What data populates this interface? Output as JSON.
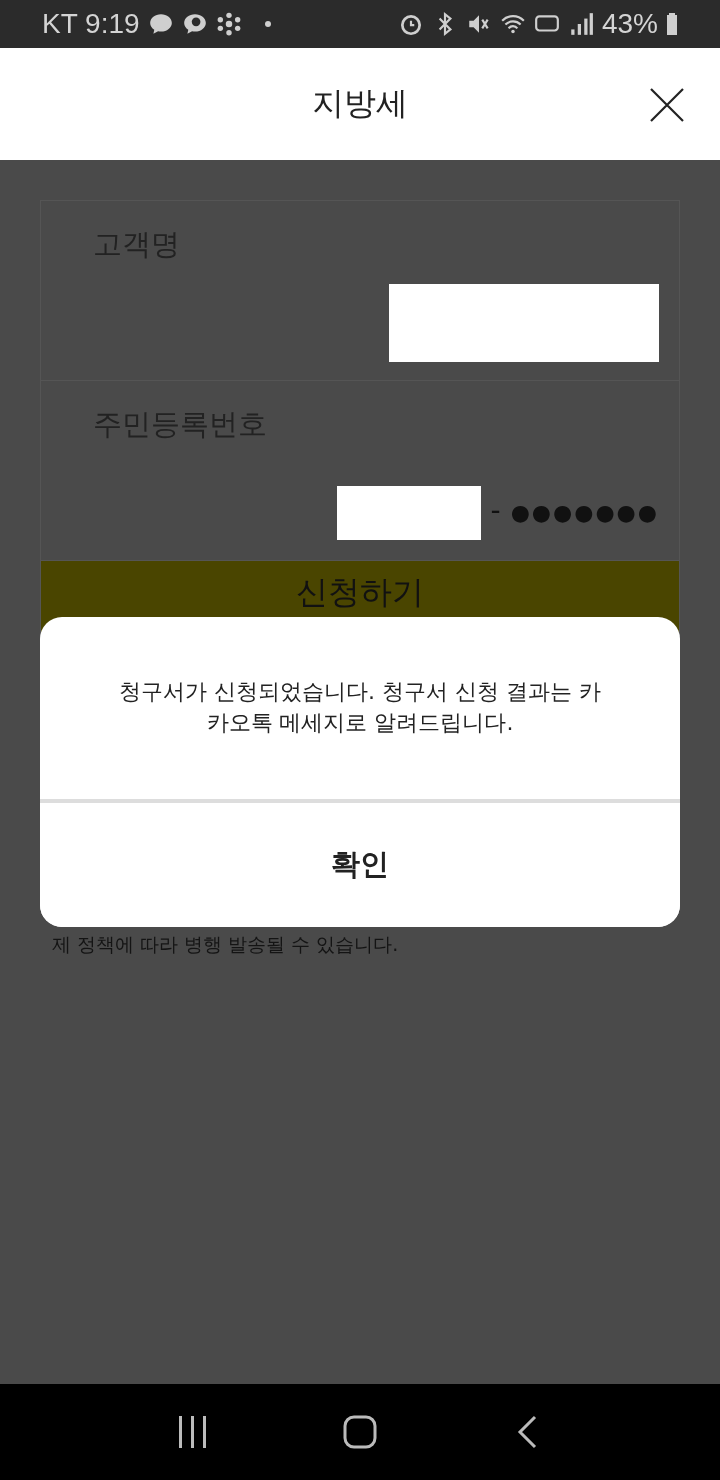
{
  "status_bar": {
    "carrier_time": "KT 9:19",
    "battery": "43%"
  },
  "header": {
    "title": "지방세"
  },
  "form": {
    "fields": [
      {
        "label": "고객명",
        "kind": "text"
      },
      {
        "label": "주민등록번호",
        "kind": "resident",
        "separator": "-",
        "masked": "●●●●●●●"
      }
    ],
    "submit": "신청하기",
    "notice": "제 정책에 따라 병행 발송될 수 있습니다."
  },
  "dialog": {
    "message": "청구서가 신청되었습니다. 청구서 신청 결과는 카카오톡 메세지로 알려드립니다.",
    "confirm": "확인"
  }
}
